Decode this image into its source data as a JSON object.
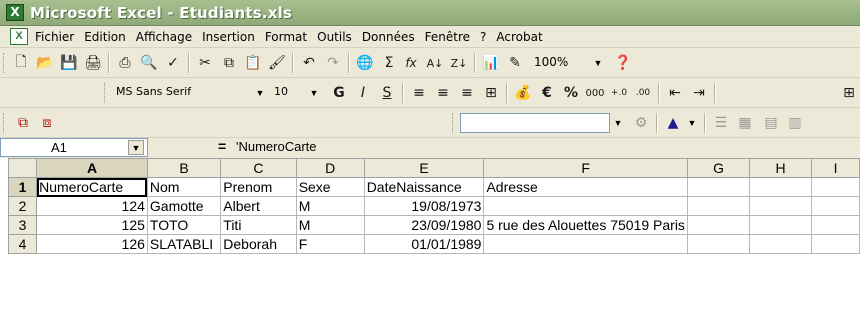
{
  "window": {
    "title": "Microsoft Excel - Etudiants.xls"
  },
  "menu": [
    "Fichier",
    "Edition",
    "Affichage",
    "Insertion",
    "Format",
    "Outils",
    "Données",
    "Fenêtre",
    "?",
    "Acrobat"
  ],
  "toolbar": {
    "zoom": "100%",
    "font_name": "MS Sans Serif",
    "font_size": "10"
  },
  "formula_bar": {
    "name_box": "A1",
    "equals": "=",
    "content": "'NumeroCarte"
  },
  "sheet": {
    "columns": [
      "A",
      "B",
      "C",
      "D",
      "E",
      "F",
      "G",
      "H",
      "I"
    ],
    "rows": [
      {
        "num": "1",
        "cells": [
          "NumeroCarte",
          "Nom",
          "Prenom",
          "Sexe",
          "DateNaissance",
          "Adresse",
          "",
          "",
          ""
        ]
      },
      {
        "num": "2",
        "cells": [
          "124",
          "Gamotte",
          "Albert",
          "M",
          "19/08/1973",
          "",
          "",
          "",
          ""
        ]
      },
      {
        "num": "3",
        "cells": [
          "125",
          "TOTO",
          "Titi",
          "M",
          "23/09/1980",
          "5 rue des Alouettes 75019 Paris",
          "",
          "",
          ""
        ]
      },
      {
        "num": "4",
        "cells": [
          "126",
          "SLATABLI",
          "Deborah",
          "F",
          "01/01/1989",
          "",
          "",
          "",
          ""
        ]
      }
    ]
  }
}
